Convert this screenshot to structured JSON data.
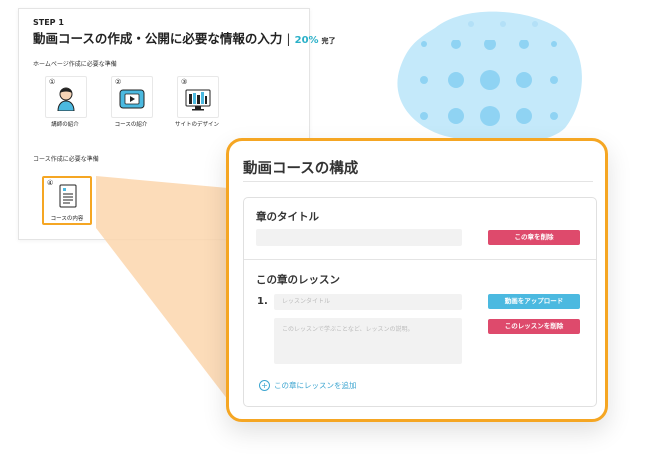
{
  "step": {
    "label": "STEP 1",
    "title": "動画コースの作成・公開に必要な情報の入力",
    "separator": "|",
    "percent": "20%",
    "percent_suffix": "完了"
  },
  "homepage_section": {
    "label": "ホームページ作成に必要な準備",
    "items": [
      {
        "num": "①",
        "label": "講師の紹介",
        "icon": "person-icon"
      },
      {
        "num": "②",
        "label": "コースの紹介",
        "icon": "video-play-icon"
      },
      {
        "num": "③",
        "label": "サイトのデザイン",
        "icon": "website-design-icon"
      }
    ]
  },
  "course_section": {
    "label": "コース作成に必要な準備",
    "items": [
      {
        "num": "④",
        "label": "コースの内容",
        "icon": "document-icon"
      }
    ]
  },
  "panel": {
    "title": "動画コースの構成",
    "chapter_title_label": "章のタイトル",
    "chapter_title_value": "",
    "delete_chapter": "この章を削除",
    "lessons_label": "この章のレッスン",
    "lesson_number": "1.",
    "lesson_title_placeholder": "レッスンタイトル",
    "lesson_desc_placeholder": "このレッスンで学ぶことなど、レッスンの説明。",
    "upload_video": "動画をアップロード",
    "delete_lesson": "このレッスンを削除",
    "add_lesson": "この章にレッスンを追加"
  },
  "colors": {
    "accent_orange": "#f5a623",
    "delete_red": "#de4a6c",
    "upload_blue": "#4bb9e0",
    "percent_teal": "#2ab0c8",
    "blob_blue": "#c4e9fa"
  }
}
